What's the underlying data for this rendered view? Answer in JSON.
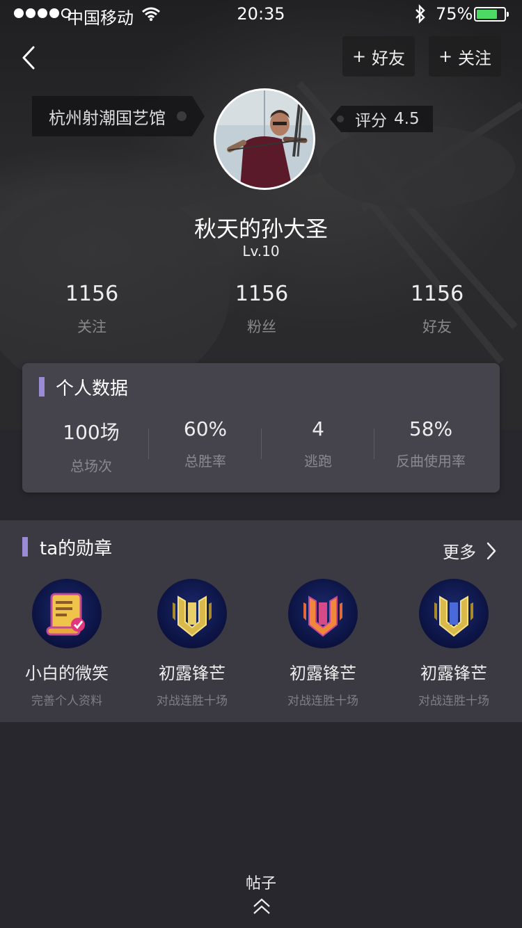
{
  "status_bar": {
    "carrier": "中国移动",
    "time": "20:35",
    "battery_pct": "75%",
    "battery_level": 0.75,
    "signal_bars": 4
  },
  "header": {
    "add_friend_plus": "+",
    "add_friend_label": "好友",
    "follow_plus": "+",
    "follow_label": "关注"
  },
  "profile": {
    "club": "杭州射潮国艺馆",
    "rating_label": "评分",
    "rating_value": "4.5",
    "username": "秋天的孙大圣",
    "level": "Lv.10"
  },
  "social_stats": [
    {
      "value": "1156",
      "label": "关注"
    },
    {
      "value": "1156",
      "label": "粉丝"
    },
    {
      "value": "1156",
      "label": "好友"
    }
  ],
  "personal_data": {
    "title": "个人数据",
    "metrics": [
      {
        "value": "100场",
        "label": "总场次"
      },
      {
        "value": "60%",
        "label": "总胜率"
      },
      {
        "value": "4",
        "label": "逃跑"
      },
      {
        "value": "58%",
        "label": "反曲使用率"
      }
    ]
  },
  "medals": {
    "title": "ta的勋章",
    "more_label": "更多",
    "items": [
      {
        "name": "小白的微笑",
        "desc": "完善个人资料",
        "icon": "scroll-badge-icon"
      },
      {
        "name": "初露锋芒",
        "desc": "对战连胜十场",
        "icon": "shield-gold-badge-icon"
      },
      {
        "name": "初露锋芒",
        "desc": "对战连胜十场",
        "icon": "shield-orange-badge-icon"
      },
      {
        "name": "初露锋芒",
        "desc": "对战连胜十场",
        "icon": "shield-gold-blue-badge-icon"
      }
    ]
  },
  "footer": {
    "posts_label": "帖子"
  },
  "colors": {
    "accent_bar": "#9b8ad4",
    "battery": "#4cd964",
    "background": "#28272d",
    "card": "#45444c"
  }
}
